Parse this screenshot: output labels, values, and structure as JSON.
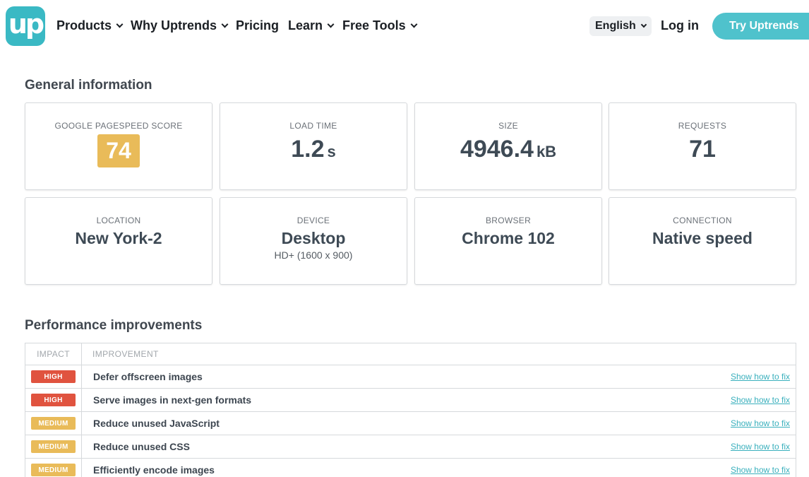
{
  "nav": {
    "logo_text": "up",
    "items": [
      {
        "label": "Products",
        "has_dropdown": true
      },
      {
        "label": "Why Uptrends",
        "has_dropdown": true
      },
      {
        "label": "Pricing",
        "has_dropdown": false
      },
      {
        "label": "Learn",
        "has_dropdown": true
      },
      {
        "label": "Free Tools",
        "has_dropdown": true
      }
    ],
    "language": "English",
    "login": "Log in",
    "cta": "Try Uptrends"
  },
  "general": {
    "title": "General information",
    "cards": {
      "pagespeed": {
        "label": "GOOGLE PAGESPEED SCORE",
        "value": "74"
      },
      "load_time": {
        "label": "LOAD TIME",
        "value": "1.2",
        "unit": "s"
      },
      "size": {
        "label": "SIZE",
        "value": "4946.4",
        "unit": "kB"
      },
      "requests": {
        "label": "REQUESTS",
        "value": "71"
      },
      "location": {
        "label": "LOCATION",
        "value": "New York-2"
      },
      "device": {
        "label": "DEVICE",
        "value": "Desktop",
        "sub": "HD+ (1600 x 900)"
      },
      "browser": {
        "label": "BROWSER",
        "value": "Chrome 102"
      },
      "connection": {
        "label": "CONNECTION",
        "value": "Native speed"
      }
    }
  },
  "performance": {
    "title": "Performance improvements",
    "columns": {
      "impact": "IMPACT",
      "improvement": "IMPROVEMENT"
    },
    "fix_label": "Show how to fix",
    "rows": [
      {
        "impact": "HIGH",
        "improvement": "Defer offscreen images"
      },
      {
        "impact": "HIGH",
        "improvement": "Serve images in next-gen formats"
      },
      {
        "impact": "MEDIUM",
        "improvement": "Reduce unused JavaScript"
      },
      {
        "impact": "MEDIUM",
        "improvement": "Reduce unused CSS"
      },
      {
        "impact": "MEDIUM",
        "improvement": "Efficiently encode images"
      }
    ]
  },
  "colors": {
    "brand": "#3ab9c4",
    "score": "#e9bb59",
    "high": "#e0533f",
    "medium": "#e9bb59",
    "link": "#3ab0bd"
  }
}
